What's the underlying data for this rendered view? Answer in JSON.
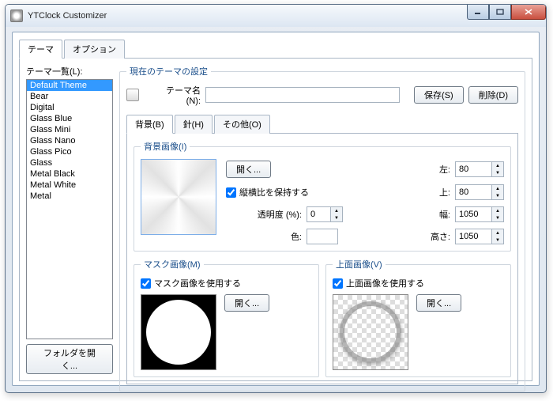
{
  "window": {
    "title": "YTClock Customizer"
  },
  "outer_tabs": {
    "theme": "テーマ",
    "option": "オプション"
  },
  "sidebar": {
    "label": "テーマ一覧(L):",
    "items": [
      "Default Theme",
      "Bear",
      "Digital",
      "Glass Blue",
      "Glass Mini",
      "Glass Nano",
      "Glass Pico",
      "Glass",
      "Metal Black",
      "Metal White",
      "Metal"
    ],
    "selected": 0,
    "open_folder": "フォルダを開く..."
  },
  "theme_settings": {
    "legend": "現在のテーマの設定",
    "name_label": "テーマ名(N):",
    "name_value": "",
    "save": "保存(S)",
    "delete": "削除(D)"
  },
  "inner_tabs": {
    "bg": "背景(B)",
    "hands": "針(H)",
    "other": "その他(O)"
  },
  "bg": {
    "legend": "背景画像(I)",
    "open": "開く...",
    "keep_aspect": "縦横比を保持する",
    "opacity_label": "透明度 (%):",
    "opacity": "0",
    "color_label": "色:",
    "left_label": "左:",
    "left": "80",
    "top_label": "上:",
    "top": "80",
    "width_label": "幅:",
    "width": "1050",
    "height_label": "高さ:",
    "height": "1050"
  },
  "mask": {
    "legend": "マスク画像(M)",
    "use": "マスク画像を使用する",
    "open": "開く..."
  },
  "front": {
    "legend": "上面画像(V)",
    "use": "上面画像を使用する",
    "open": "開く..."
  }
}
